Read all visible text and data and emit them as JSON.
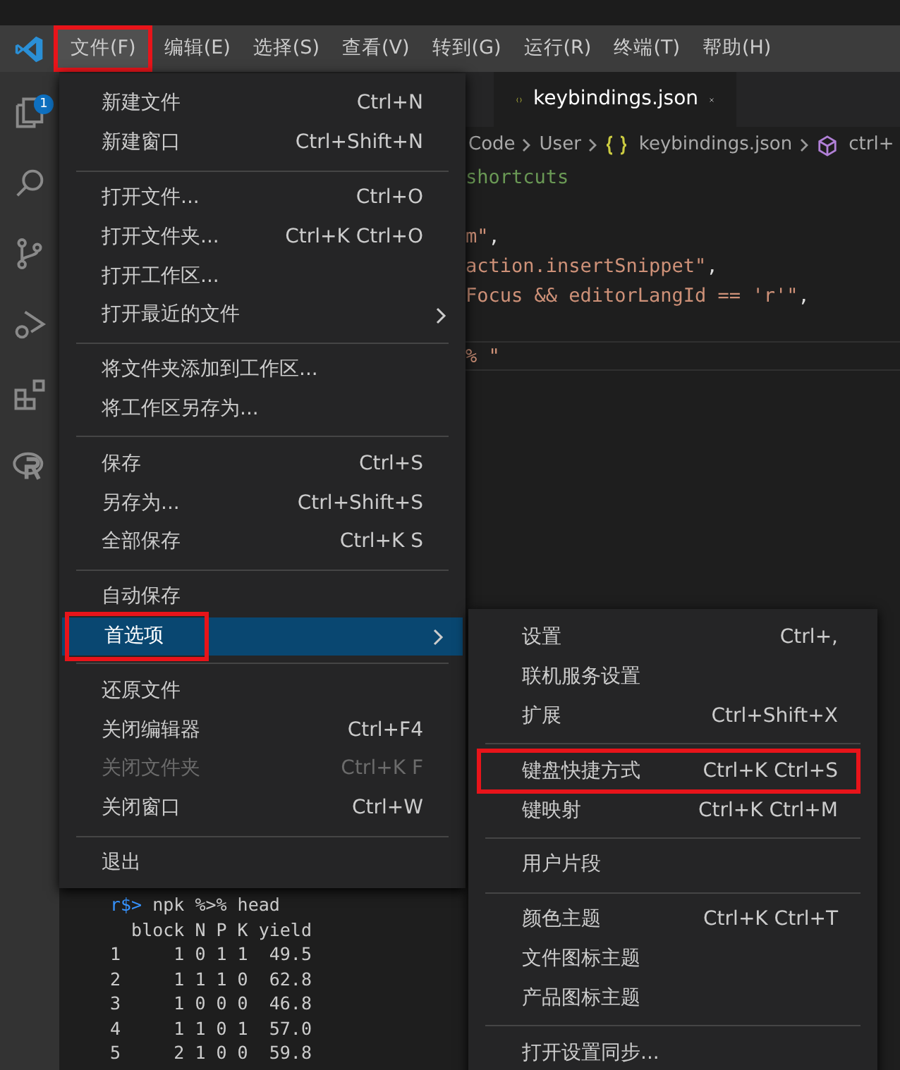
{
  "menubar": [
    {
      "label": "文件(F)",
      "selected": true,
      "annotated": true
    },
    {
      "label": "编辑(E)",
      "selected": false,
      "annotated": false
    },
    {
      "label": "选择(S)",
      "selected": false,
      "annotated": false
    },
    {
      "label": "查看(V)",
      "selected": false,
      "annotated": false
    },
    {
      "label": "转到(G)",
      "selected": false,
      "annotated": false
    },
    {
      "label": "运行(R)",
      "selected": false,
      "annotated": false
    },
    {
      "label": "终端(T)",
      "selected": false,
      "annotated": false
    },
    {
      "label": "帮助(H)",
      "selected": false,
      "annotated": false
    }
  ],
  "activity_bar": {
    "badge": "1"
  },
  "tab": {
    "label": "keybindings.json"
  },
  "breadcrumbs": [
    {
      "label": "Code",
      "kind": "folder"
    },
    {
      "label": "User",
      "kind": "folder"
    },
    {
      "label": "keybindings.json",
      "kind": "file"
    },
    {
      "label": "ctrl+",
      "kind": "symbol"
    }
  ],
  "code_lines": [
    {
      "kind": "code",
      "current": false,
      "tokens": [
        {
          "text": "shortcuts",
          "kind": "comment"
        }
      ]
    },
    {
      "kind": "blank",
      "current": false
    },
    {
      "kind": "code",
      "current": false,
      "tokens": [
        {
          "text": "m\"",
          "kind": "string"
        },
        {
          "text": ",",
          "kind": "punct"
        }
      ]
    },
    {
      "kind": "code",
      "current": false,
      "tokens": [
        {
          "text": "action.insertSnippet\"",
          "kind": "string"
        },
        {
          "text": ",",
          "kind": "punct"
        }
      ]
    },
    {
      "kind": "code",
      "current": false,
      "tokens": [
        {
          "text": "Focus && editorLangId == 'r'\"",
          "kind": "string"
        },
        {
          "text": ",",
          "kind": "punct"
        }
      ]
    },
    {
      "kind": "blank",
      "current": false
    },
    {
      "kind": "code",
      "current": true,
      "tokens": [
        {
          "text": "% \"",
          "kind": "string"
        }
      ]
    }
  ],
  "terminal": [
    {
      "tokens": [
        {
          "text": "r$>",
          "kind": "prompt"
        },
        {
          "text": " npk %>% head",
          "kind": "text"
        }
      ]
    },
    {
      "tokens": [
        {
          "text": "  block N P K yield",
          "kind": "text"
        }
      ]
    },
    {
      "tokens": [
        {
          "text": "1     1 0 1 1  49.5",
          "kind": "text"
        }
      ]
    },
    {
      "tokens": [
        {
          "text": "2     1 1 1 0  62.8",
          "kind": "text"
        }
      ]
    },
    {
      "tokens": [
        {
          "text": "3     1 0 0 0  46.8",
          "kind": "text"
        }
      ]
    },
    {
      "tokens": [
        {
          "text": "4     1 1 0 1  57.0",
          "kind": "text"
        }
      ]
    },
    {
      "tokens": [
        {
          "text": "5     2 1 0 0  59.8",
          "kind": "text"
        }
      ]
    }
  ],
  "file_menu": [
    {
      "kind": "item",
      "label": "新建文件",
      "shortcut": "Ctrl+N",
      "submenu": false,
      "selected": false,
      "disabled": false,
      "annotated": false
    },
    {
      "kind": "item",
      "label": "新建窗口",
      "shortcut": "Ctrl+Shift+N",
      "submenu": false,
      "selected": false,
      "disabled": false,
      "annotated": false
    },
    {
      "kind": "separator"
    },
    {
      "kind": "item",
      "label": "打开文件...",
      "shortcut": "Ctrl+O",
      "submenu": false,
      "selected": false,
      "disabled": false,
      "annotated": false
    },
    {
      "kind": "item",
      "label": "打开文件夹...",
      "shortcut": "Ctrl+K Ctrl+O",
      "submenu": false,
      "selected": false,
      "disabled": false,
      "annotated": false
    },
    {
      "kind": "item",
      "label": "打开工作区...",
      "submenu": false,
      "selected": false,
      "disabled": false,
      "annotated": false
    },
    {
      "kind": "item",
      "label": "打开最近的文件",
      "submenu": true,
      "selected": false,
      "disabled": false,
      "annotated": false
    },
    {
      "kind": "separator"
    },
    {
      "kind": "item",
      "label": "将文件夹添加到工作区...",
      "submenu": false,
      "selected": false,
      "disabled": false,
      "annotated": false
    },
    {
      "kind": "item",
      "label": "将工作区另存为...",
      "submenu": false,
      "selected": false,
      "disabled": false,
      "annotated": false
    },
    {
      "kind": "separator"
    },
    {
      "kind": "item",
      "label": "保存",
      "shortcut": "Ctrl+S",
      "submenu": false,
      "selected": false,
      "disabled": false,
      "annotated": false
    },
    {
      "kind": "item",
      "label": "另存为...",
      "shortcut": "Ctrl+Shift+S",
      "submenu": false,
      "selected": false,
      "disabled": false,
      "annotated": false
    },
    {
      "kind": "item",
      "label": "全部保存",
      "shortcut": "Ctrl+K S",
      "submenu": false,
      "selected": false,
      "disabled": false,
      "annotated": false
    },
    {
      "kind": "separator"
    },
    {
      "kind": "item",
      "label": "自动保存",
      "submenu": false,
      "selected": false,
      "disabled": false,
      "annotated": false
    },
    {
      "kind": "item",
      "label": "首选项",
      "submenu": true,
      "selected": true,
      "disabled": false,
      "annotated": true
    },
    {
      "kind": "separator"
    },
    {
      "kind": "item",
      "label": "还原文件",
      "submenu": false,
      "selected": false,
      "disabled": false,
      "annotated": false
    },
    {
      "kind": "item",
      "label": "关闭编辑器",
      "shortcut": "Ctrl+F4",
      "submenu": false,
      "selected": false,
      "disabled": false,
      "annotated": false
    },
    {
      "kind": "item",
      "label": "关闭文件夹",
      "shortcut": "Ctrl+K F",
      "submenu": false,
      "selected": false,
      "disabled": true,
      "annotated": false
    },
    {
      "kind": "item",
      "label": "关闭窗口",
      "shortcut": "Ctrl+W",
      "submenu": false,
      "selected": false,
      "disabled": false,
      "annotated": false
    },
    {
      "kind": "separator"
    },
    {
      "kind": "item",
      "label": "退出",
      "submenu": false,
      "selected": false,
      "disabled": false,
      "annotated": false
    }
  ],
  "preferences_submenu": [
    {
      "kind": "item",
      "label": "设置",
      "shortcut": "Ctrl+,",
      "annotated": false
    },
    {
      "kind": "item",
      "label": "联机服务设置",
      "annotated": false
    },
    {
      "kind": "item",
      "label": "扩展",
      "shortcut": "Ctrl+Shift+X",
      "annotated": false
    },
    {
      "kind": "separator"
    },
    {
      "kind": "item",
      "label": "键盘快捷方式",
      "shortcut": "Ctrl+K Ctrl+S",
      "annotated": true
    },
    {
      "kind": "item",
      "label": "键映射",
      "shortcut": "Ctrl+K Ctrl+M",
      "annotated": false
    },
    {
      "kind": "separator"
    },
    {
      "kind": "item",
      "label": "用户片段",
      "annotated": false
    },
    {
      "kind": "separator"
    },
    {
      "kind": "item",
      "label": "颜色主题",
      "shortcut": "Ctrl+K Ctrl+T",
      "annotated": false
    },
    {
      "kind": "item",
      "label": "文件图标主题",
      "annotated": false
    },
    {
      "kind": "item",
      "label": "产品图标主题",
      "annotated": false
    },
    {
      "kind": "separator"
    },
    {
      "kind": "item",
      "label": "打开设置同步...",
      "annotated": false
    }
  ]
}
